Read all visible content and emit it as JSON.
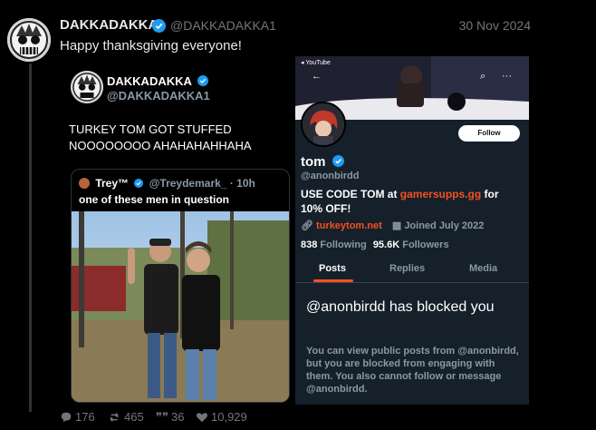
{
  "tweet": {
    "author_name": "DAKKADAKKA",
    "author_handle": "@DAKKADAKKA1",
    "date": "30 Nov 2024",
    "text": "Happy thanksgiving everyone!"
  },
  "embedded_tweet": {
    "author_name": "DAKKADAKKA",
    "author_handle": "@DAKKADAKKA1",
    "line1": "TURKEY TOM GOT STUFFED",
    "line2": "NOOOOOOOO AHAHAHAHHAHA",
    "quote": {
      "name": "Trey™",
      "handle": "@Treydemark_",
      "time": "· 10h",
      "text": "one of these men in question"
    }
  },
  "profile_screenshot": {
    "youtube_back": "◂ YouTube",
    "follow_label": "Follow",
    "name": "tom",
    "handle": "@anonbirdd",
    "bio_prefix": "USE CODE TOM at ",
    "bio_link": "gamersupps.gg",
    "bio_suffix": " for 10% OFF!",
    "website": "turkeytom.net",
    "joined": "Joined July 2022",
    "following_count": "838",
    "following_label": "Following",
    "followers_count": "95.6K",
    "followers_label": "Followers",
    "tabs": [
      "Posts",
      "Replies",
      "Media"
    ],
    "blocked_title": "@anonbirdd has blocked you",
    "blocked_body": "You can view public posts from @anonbirdd, but you are blocked from engaging with them. You also cannot follow or message @anonbirdd."
  },
  "actions": {
    "replies": "176",
    "reposts": "465",
    "quotes": "36",
    "likes": "10,929"
  },
  "colors": {
    "verified": "#1d9bf0",
    "accent_orange": "#f4511e",
    "muted": "#71767b"
  }
}
